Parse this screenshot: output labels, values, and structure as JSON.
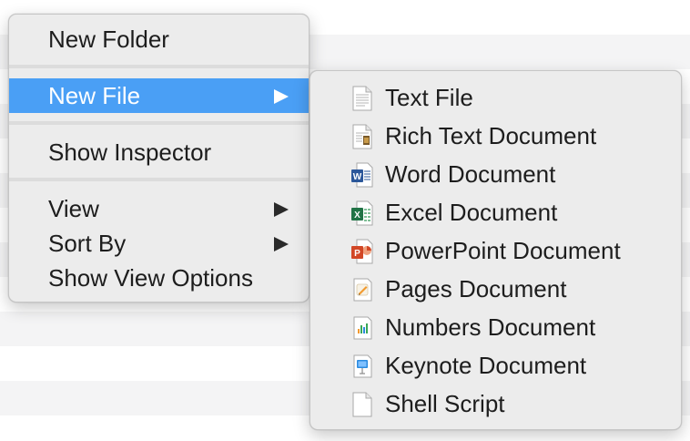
{
  "main_menu": {
    "items": [
      {
        "label": "New Folder"
      },
      {
        "label": "New File",
        "has_submenu": true,
        "selected": true
      },
      {
        "label": "Show Inspector"
      },
      {
        "label": "View",
        "has_submenu": true
      },
      {
        "label": "Sort By",
        "has_submenu": true
      },
      {
        "label": "Show View Options"
      }
    ]
  },
  "submenu": {
    "items": [
      {
        "label": "Text File",
        "icon": "text-file-icon"
      },
      {
        "label": "Rich Text Document",
        "icon": "rich-text-icon"
      },
      {
        "label": "Word Document",
        "icon": "word-icon"
      },
      {
        "label": "Excel Document",
        "icon": "excel-icon"
      },
      {
        "label": "PowerPoint Document",
        "icon": "powerpoint-icon"
      },
      {
        "label": "Pages Document",
        "icon": "pages-icon"
      },
      {
        "label": "Numbers Document",
        "icon": "numbers-icon"
      },
      {
        "label": "Keynote Document",
        "icon": "keynote-icon"
      },
      {
        "label": "Shell Script",
        "icon": "shell-script-icon"
      }
    ]
  },
  "colors": {
    "selection": "#4a9ff5",
    "menu_background": "#ececec",
    "word": "#2b579a",
    "excel": "#217346",
    "powerpoint": "#d24726"
  }
}
